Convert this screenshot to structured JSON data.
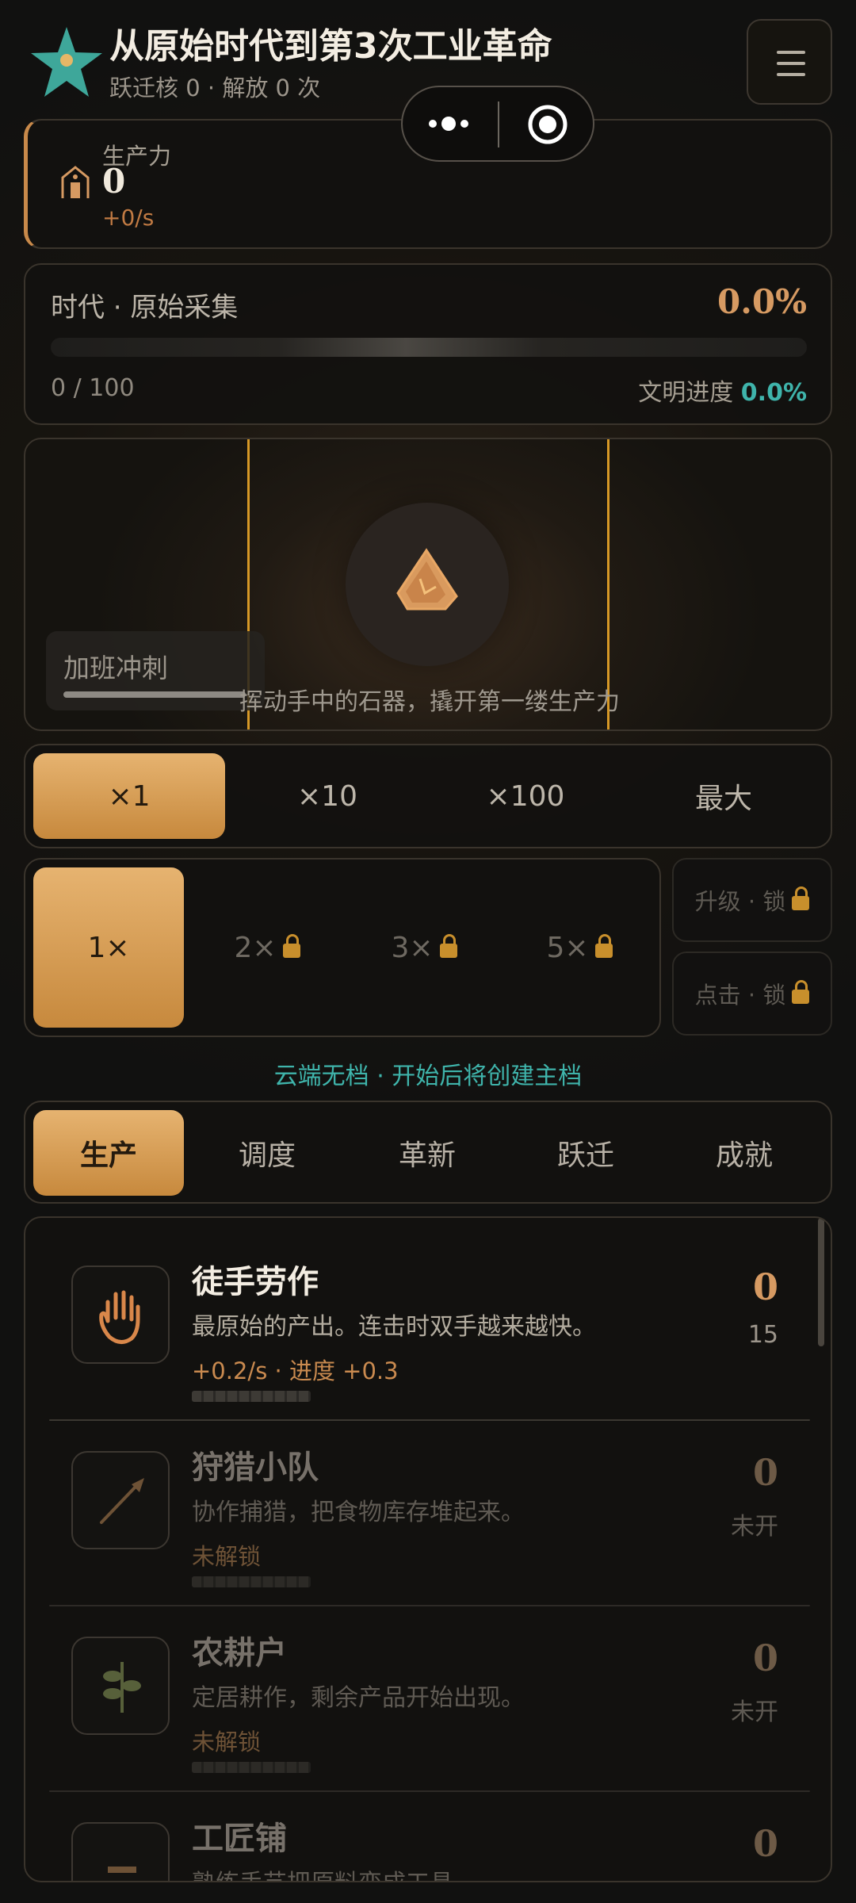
{
  "header": {
    "title": "从原始时代到第3次工业革命",
    "subtitle": "跃迁核 0 · 解放 0 次"
  },
  "productivity": {
    "label": "生产力",
    "value": "0",
    "rate": "+0/s"
  },
  "era": {
    "label": "时代 · 原始采集",
    "percent": "0.0%",
    "count": "0 / 100",
    "civ_label": "文明进度",
    "civ_percent": "0.0%"
  },
  "stage": {
    "overtime_label": "加班冲刺",
    "hint": "挥动手中的石器，撬开第一缕生产力"
  },
  "multipliers": [
    "×1",
    "×10",
    "×100",
    "最大"
  ],
  "speeds": [
    "1×",
    "2×",
    "3×",
    "5×"
  ],
  "side_buttons": [
    "升级 · 锁",
    "点击 · 锁"
  ],
  "cloud_status": "云端无档 · 开始后将创建主档",
  "tabs": [
    "生产",
    "调度",
    "革新",
    "跃迁",
    "成就"
  ],
  "items": [
    {
      "name": "徒手劳作",
      "desc": "最原始的产出。连击时双手越来越快。",
      "stat": "+0.2/s · 进度 +0.3",
      "count": "0",
      "sub": "15",
      "icon": "hand-icon"
    },
    {
      "name": "狩猎小队",
      "desc": "协作捕猎，把食物库存堆起来。",
      "stat": "未解锁",
      "count": "0",
      "sub": "未开",
      "icon": "spear-icon"
    },
    {
      "name": "农耕户",
      "desc": "定居耕作，剩余产品开始出现。",
      "stat": "未解锁",
      "count": "0",
      "sub": "未开",
      "icon": "plant-icon"
    },
    {
      "name": "工匠铺",
      "desc": "熟练手艺把原料变成工具。",
      "stat": "",
      "count": "0",
      "sub": "",
      "icon": "tool-icon"
    }
  ],
  "colors": {
    "accent": "#d69a62",
    "gold": "#e6b370",
    "teal": "#3fb4ab",
    "background": "#121110"
  }
}
